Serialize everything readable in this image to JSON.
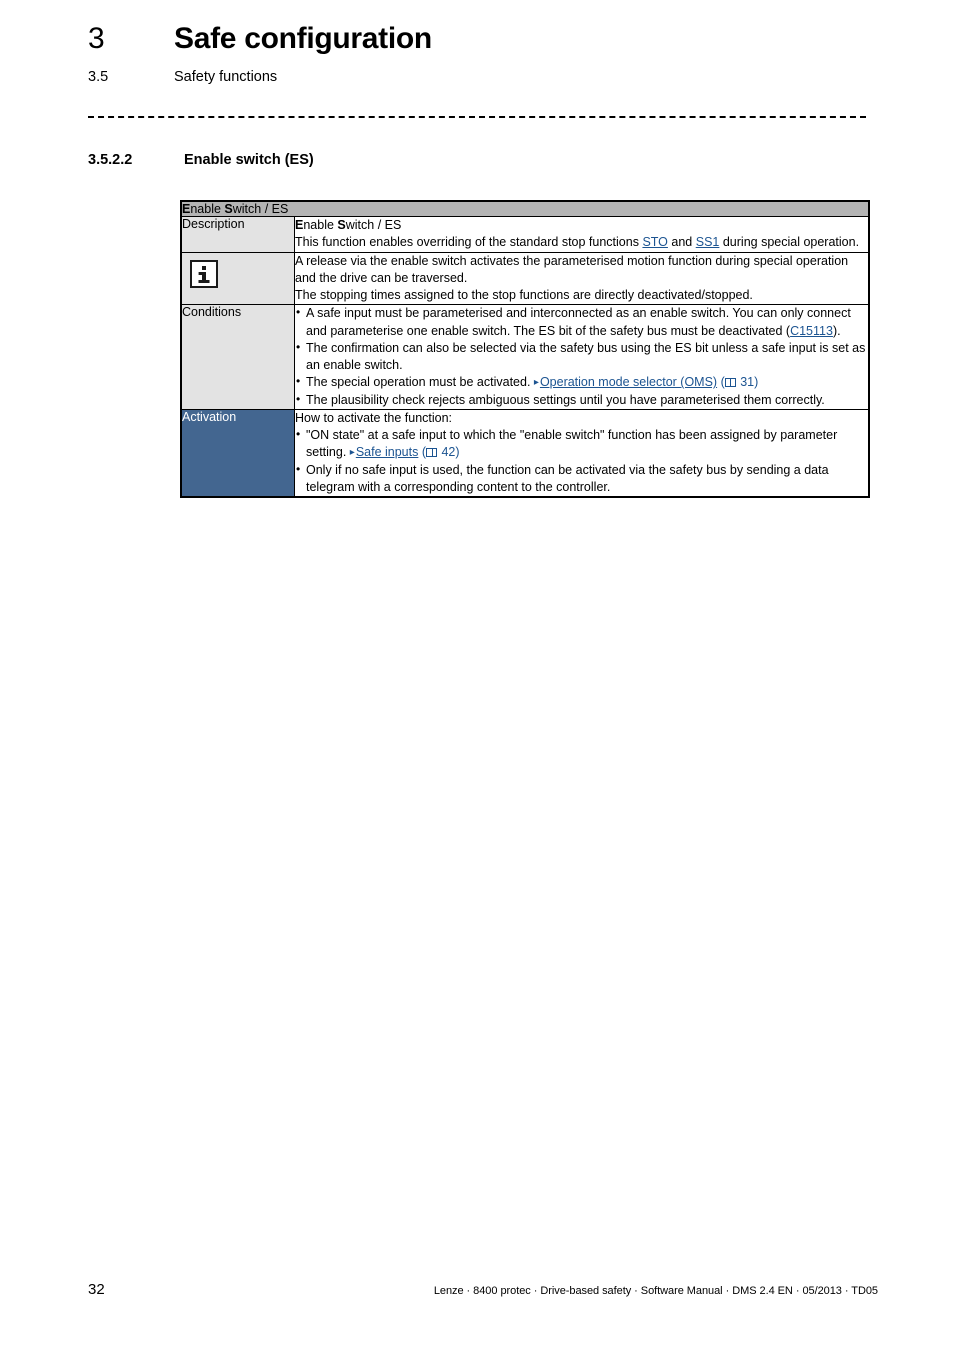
{
  "header": {
    "chapter_number": "3",
    "chapter_title": "Safe configuration",
    "section_number": "3.5",
    "section_title": "Safety functions"
  },
  "subsection": {
    "number": "3.5.2.2",
    "title": "Enable switch (ES)"
  },
  "table": {
    "caption": "Enable Switch / ES",
    "caption_bold_letters": [
      "E",
      "S"
    ],
    "rows": {
      "description": {
        "label": "Description",
        "heading": "Enable Switch / ES",
        "text_before_link1": "This function enables overriding of the standard stop functions ",
        "link1": "STO",
        "text_between_links": " and ",
        "link2": "SS1",
        "text_after_link2": " during special operation."
      },
      "note": {
        "icon": "info-icon",
        "line1": "A release via the enable switch activates the parameterised motion function during special operation and the drive can be traversed.",
        "line2": "The stopping times assigned to the stop functions are directly deactivated/stopped."
      },
      "conditions": {
        "label": "Conditions",
        "items": [
          {
            "text_before_link": "A safe input must be parameterised and interconnected as an enable switch. You can only connect and parameterise one enable switch. The ES bit of the safety bus must be deactivated (",
            "link": "C15113",
            "text_after_link": ")."
          },
          {
            "text_before_link": "The confirmation can also be selected via the safety bus using the ES bit unless a safe input is set as an enable switch.",
            "link": "",
            "text_after_link": ""
          },
          {
            "text_before_link": "The special operation must be activated. ",
            "link": "Operation mode selector (OMS)",
            "page_ref": "31",
            "text_after_link": ""
          },
          {
            "text_before_link": "The plausibility check rejects ambiguous settings until you have parameterised them correctly.",
            "link": "",
            "text_after_link": ""
          }
        ]
      },
      "activation": {
        "label": "Activation",
        "label_background": "#436690",
        "intro": "How to activate the function:",
        "items": [
          {
            "text_before_link": "\"ON state\" at a safe input to which the \"enable switch\" function has been assigned by parameter setting. ",
            "link": "Safe inputs",
            "page_ref": "42",
            "text_after_link": ""
          },
          {
            "text_before_link": "Only if no safe input is used, the function can be activated via the safety bus by sending a data telegram with a corresponding content to the controller.",
            "link": "",
            "text_after_link": ""
          }
        ]
      }
    }
  },
  "footer": {
    "page_number": "32",
    "imprint": "Lenze · 8400 protec · Drive-based safety · Software Manual · DMS 2.4 EN · 05/2013 · TD05"
  },
  "colors": {
    "accent_blue": "#436690",
    "link_blue": "#1c5491",
    "header_gray": "#b4b4b4",
    "label_gray": "#e3e3e3"
  }
}
